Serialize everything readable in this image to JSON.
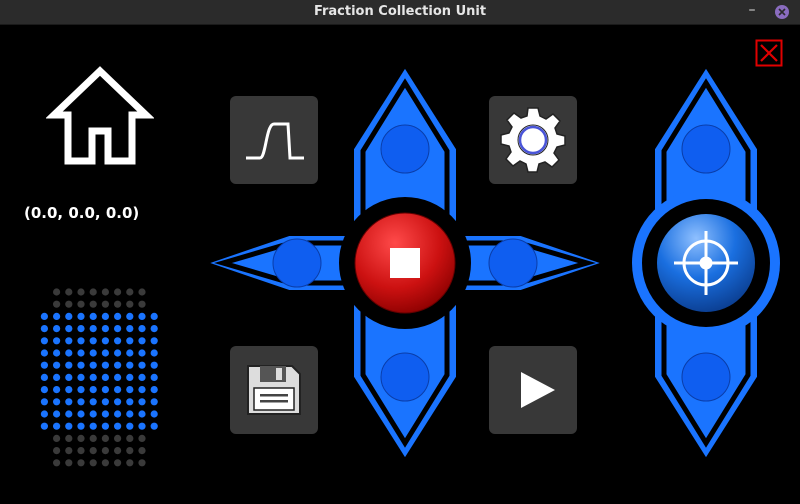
{
  "window": {
    "title": "Fraction Collection Unit",
    "minimize_glyph": "–"
  },
  "position": {
    "readout": "(0.0, 0.0, 0.0)"
  },
  "icons": {
    "home": "home-icon",
    "pulse": "pulse-icon",
    "settings": "gear-icon",
    "save": "floppy-disk-icon",
    "play": "play-icon",
    "stop": "stop-icon",
    "target": "crosshair-icon",
    "close": "close-icon"
  },
  "colors": {
    "accent_blue": "#1a74ff",
    "stop_red": "#cc1111",
    "close_red": "#e00000",
    "tile_gray": "#383838",
    "well_active": "#1a74ff",
    "well_inactive": "#3a3a3a"
  },
  "well_plate": {
    "rows": [
      {
        "active": false,
        "count": 8
      },
      {
        "active": false,
        "count": 8
      },
      {
        "active": true,
        "count": 10
      },
      {
        "active": true,
        "count": 10
      },
      {
        "active": true,
        "count": 10
      },
      {
        "active": true,
        "count": 10
      },
      {
        "active": true,
        "count": 10
      },
      {
        "active": true,
        "count": 10
      },
      {
        "active": true,
        "count": 10
      },
      {
        "active": true,
        "count": 10
      },
      {
        "active": true,
        "count": 10
      },
      {
        "active": true,
        "count": 10
      },
      {
        "active": false,
        "count": 8
      },
      {
        "active": false,
        "count": 8
      },
      {
        "active": false,
        "count": 8
      }
    ]
  }
}
